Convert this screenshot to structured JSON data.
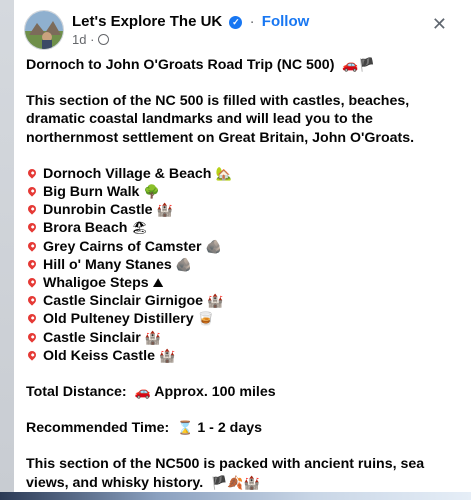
{
  "header": {
    "page_name": "Let's Explore The UK",
    "separator": "·",
    "follow_label": "Follow",
    "time": "1d",
    "close_glyph": "✕",
    "verified_glyph": "✓"
  },
  "post": {
    "title": "Dornoch to John O'Groats Road Trip (NC 500)",
    "title_emoji": "🚗🏴",
    "intro": "This section of the NC 500 is filled with castles, beaches, dramatic coastal landmarks and will lead you to the northernmost settlement on Great Britain, John O'Groats.",
    "places": [
      {
        "name": "Dornoch Village & Beach",
        "emoji": "🏡"
      },
      {
        "name": "Big Burn Walk",
        "emoji": "🌳"
      },
      {
        "name": "Dunrobin Castle",
        "emoji": "🏰"
      },
      {
        "name": "Brora Beach",
        "emoji": "🏖"
      },
      {
        "name": "Grey Cairns of Camster",
        "emoji": "🪨"
      },
      {
        "name": "Hill o' Many Stanes",
        "emoji": "🪨"
      },
      {
        "name": "Whaligoe Steps",
        "emoji": "⛰"
      },
      {
        "name": "Castle Sinclair Girnigoe",
        "emoji": "🏰"
      },
      {
        "name": "Old Pulteney Distillery",
        "emoji": "🥃"
      },
      {
        "name": "Castle Sinclair",
        "emoji": "🏰"
      },
      {
        "name": "Old Keiss Castle",
        "emoji": "🏰"
      }
    ],
    "distance_label": "Total Distance:",
    "distance_emoji": "🚗",
    "distance_value": "Approx. 100 miles",
    "time_label": "Recommended Time:",
    "time_emoji": "⌛",
    "time_value": "1 - 2 days",
    "closing": "This section of the NC500 is packed with ancient ruins, sea views, and whisky history.",
    "closing_emoji": "🏴🍂🏰"
  }
}
